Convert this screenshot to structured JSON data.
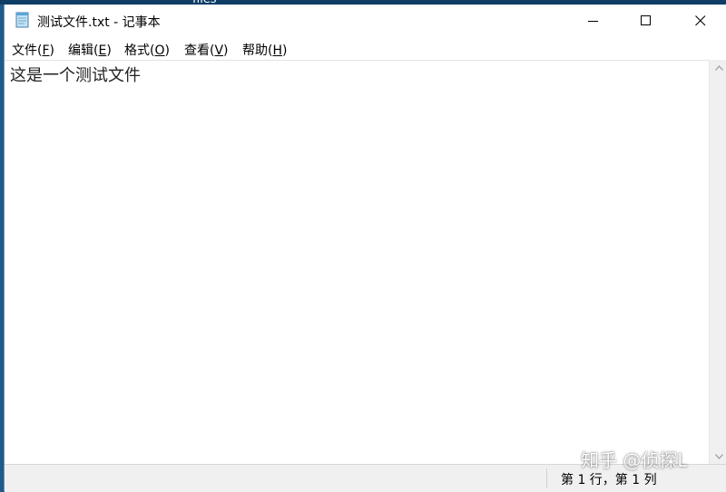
{
  "background_window_peek": "files",
  "window": {
    "title": "测试文件.txt - 记事本",
    "app_icon": "notepad-icon",
    "controls": {
      "minimize_icon": "minimize-icon",
      "maximize_icon": "maximize-icon",
      "close_icon": "close-icon"
    }
  },
  "menu": {
    "file": {
      "label": "文件(",
      "key": "F",
      "end": ")"
    },
    "edit": {
      "label": "编辑(",
      "key": "E",
      "end": ")"
    },
    "format": {
      "label": "格式(",
      "key": "O",
      "end": ")"
    },
    "view": {
      "label": "查看(",
      "key": "V",
      "end": ")"
    },
    "help": {
      "label": "帮助(",
      "key": "H",
      "end": ")"
    }
  },
  "editor": {
    "content": "这是一个测试文件"
  },
  "statusbar": {
    "position": "第 1 行，第 1 列"
  },
  "watermark": "知乎 @侦探L",
  "colors": {
    "desktop": "#1e5a8a",
    "window_bg": "#ffffff",
    "statusbar_bg": "#f0f0f0"
  }
}
